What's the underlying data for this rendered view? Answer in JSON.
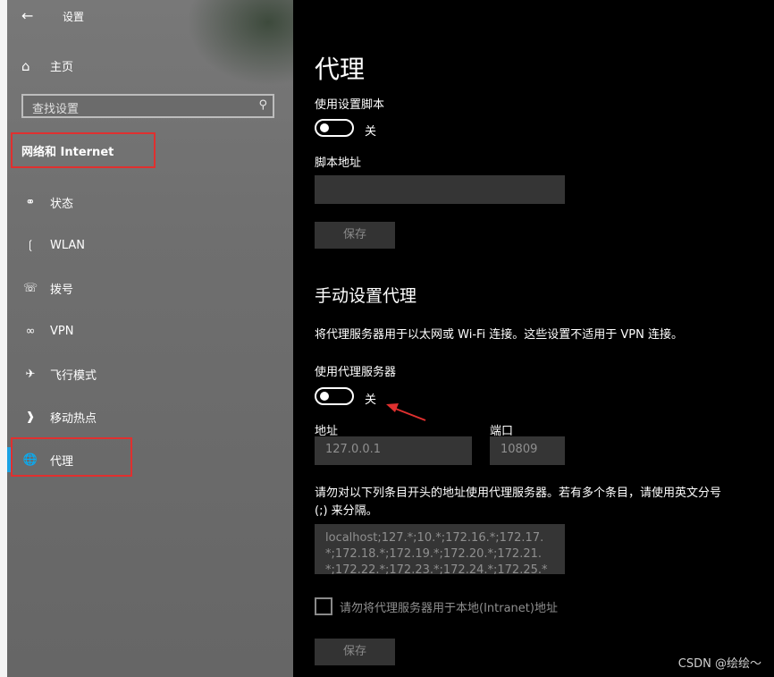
{
  "sidebar": {
    "back_icon": "arrow-left-icon",
    "app_title": "设置",
    "home": {
      "icon": "home-icon",
      "label": "主页"
    },
    "search": {
      "placeholder": "查找设置",
      "icon": "search-icon"
    },
    "section_title": "网络和 Internet",
    "items": [
      {
        "icon": "globe-status-icon",
        "label": "状态"
      },
      {
        "icon": "wifi-icon",
        "label": "WLAN"
      },
      {
        "icon": "dialup-icon",
        "label": "拨号"
      },
      {
        "icon": "vpn-icon",
        "label": "VPN"
      },
      {
        "icon": "airplane-icon",
        "label": "飞行模式"
      },
      {
        "icon": "hotspot-icon",
        "label": "移动热点"
      },
      {
        "icon": "globe-icon",
        "label": "代理",
        "active": true
      }
    ]
  },
  "content": {
    "title": "代理",
    "auto": {
      "script_toggle_label": "使用设置脚本",
      "script_toggle_state": "关",
      "script_address_label": "脚本地址",
      "script_address_value": "",
      "save_label": "保存"
    },
    "manual": {
      "heading": "手动设置代理",
      "description": "将代理服务器用于以太网或 Wi-Fi 连接。这些设置不适用于 VPN 连接。",
      "proxy_toggle_label": "使用代理服务器",
      "proxy_toggle_state": "关",
      "address_label": "地址",
      "address_value": "127.0.0.1",
      "port_label": "端口",
      "port_value": "10809",
      "exceptions_description": "请勿对以下列条目开头的地址使用代理服务器。若有多个条目，请使用英文分号 (;) 来分隔。",
      "exceptions_value": "localhost;127.*;10.*;172.16.*;172.17.*;172.18.*;172.19.*;172.20.*;172.21.*;172.22.*;172.23.*;172.24.*;172.25.*",
      "bypass_local_label": "请勿将代理服务器用于本地(Intranet)地址",
      "save_label": "保存"
    },
    "watermark": "CSDN @绘绘～"
  },
  "colors": {
    "annotation_red": "#e0302f",
    "accent_blue": "#1ba1e2"
  }
}
